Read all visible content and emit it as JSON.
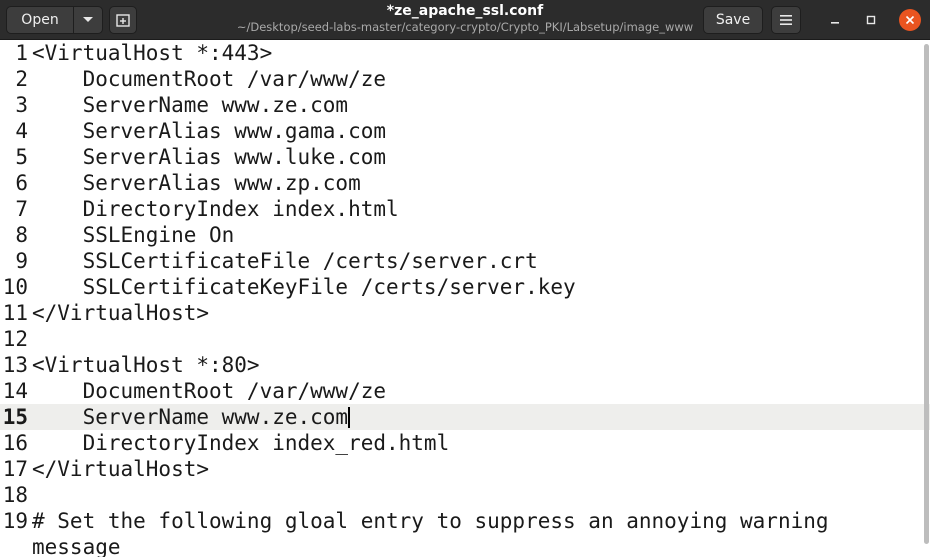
{
  "window": {
    "title": "*ze_apache_ssl.conf",
    "path": "~/Desktop/seed-labs-master/category-crypto/Crypto_PKI/Labsetup/image_www"
  },
  "toolbar": {
    "open_label": "Open",
    "save_label": "Save"
  },
  "icons": {
    "open_menu": "chevron-down-icon",
    "new_tab": "new-tab-icon",
    "menu": "hamburger-menu-icon",
    "minimize": "minimize-icon",
    "maximize": "maximize-icon",
    "close": "close-icon"
  },
  "colors": {
    "headerbar": "#2c2c2c",
    "close_button": "#e95420",
    "current_line": "#eeeeec"
  },
  "editor": {
    "current_line": 15,
    "lines": [
      {
        "n": "1",
        "text": "<VirtualHost *:443>"
      },
      {
        "n": "2",
        "text": "    DocumentRoot /var/www/ze"
      },
      {
        "n": "3",
        "text": "    ServerName www.ze.com"
      },
      {
        "n": "4",
        "text": "    ServerAlias www.gama.com"
      },
      {
        "n": "5",
        "text": "    ServerAlias www.luke.com"
      },
      {
        "n": "6",
        "text": "    ServerAlias www.zp.com"
      },
      {
        "n": "7",
        "text": "    DirectoryIndex index.html"
      },
      {
        "n": "8",
        "text": "    SSLEngine On"
      },
      {
        "n": "9",
        "text": "    SSLCertificateFile /certs/server.crt"
      },
      {
        "n": "10",
        "text": "    SSLCertificateKeyFile /certs/server.key"
      },
      {
        "n": "11",
        "text": "</VirtualHost>"
      },
      {
        "n": "12",
        "text": ""
      },
      {
        "n": "13",
        "text": "<VirtualHost *:80>"
      },
      {
        "n": "14",
        "text": "    DocumentRoot /var/www/ze"
      },
      {
        "n": "15",
        "text": "    ServerName www.ze.com"
      },
      {
        "n": "16",
        "text": "    DirectoryIndex index_red.html"
      },
      {
        "n": "17",
        "text": "</VirtualHost>"
      },
      {
        "n": "18",
        "text": ""
      },
      {
        "n": "19",
        "text": "# Set the following gloal entry to suppress an annoying warning"
      },
      {
        "n": "",
        "text": "message"
      }
    ]
  }
}
